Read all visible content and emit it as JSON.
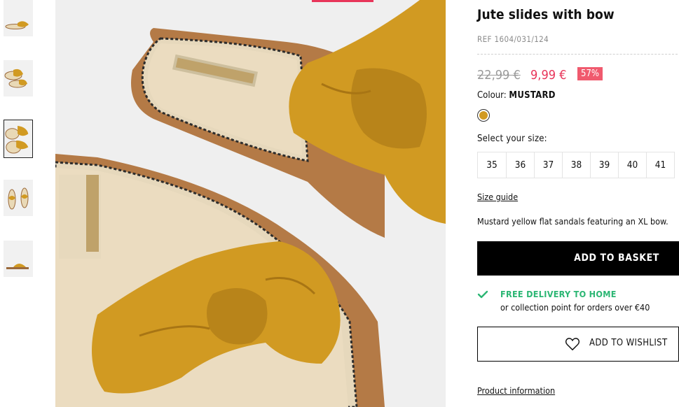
{
  "product": {
    "title": "Jute slides with bow",
    "ref": "REF 1604/031/124",
    "old_price": "22,99 €",
    "new_price": "9,99 €",
    "discount": "57%",
    "colour_label": "Colour:",
    "colour_value": "MUSTARD",
    "colour_hex": "#d19a22",
    "size_label": "Select your size:",
    "sizes": [
      "35",
      "36",
      "37",
      "38",
      "39",
      "40",
      "41"
    ],
    "size_guide": "Size guide",
    "description": "Mustard yellow flat sandals featuring an XL bow.",
    "add_to_basket": "ADD TO BASKET",
    "delivery_title": "FREE DELIVERY TO HOME",
    "delivery_sub": "or collection point for orders over €40",
    "add_to_wishlist": "ADD TO WISHLIST",
    "product_info": "Product information"
  },
  "accent_color": "#e8355a",
  "gallery": {
    "thumbnail_count": 5,
    "selected_index": 2
  }
}
